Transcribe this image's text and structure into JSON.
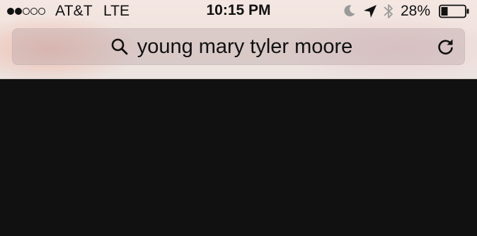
{
  "status_bar": {
    "signal_bars_filled": 2,
    "signal_bars_total": 5,
    "carrier": "AT&T",
    "network": "LTE",
    "time": "10:15 PM",
    "icons": [
      "moon-icon",
      "location-arrow-icon",
      "bluetooth-icon",
      "battery-icon"
    ],
    "battery_percent": "28%",
    "battery_level": 0.28
  },
  "browser": {
    "search_query": "young mary tyler moore",
    "search_icon": "search-icon",
    "reload_icon": "reload-icon"
  },
  "colors": {
    "page_background": "#111111",
    "chrome_background": "#efe2dd",
    "text": "#111111"
  }
}
